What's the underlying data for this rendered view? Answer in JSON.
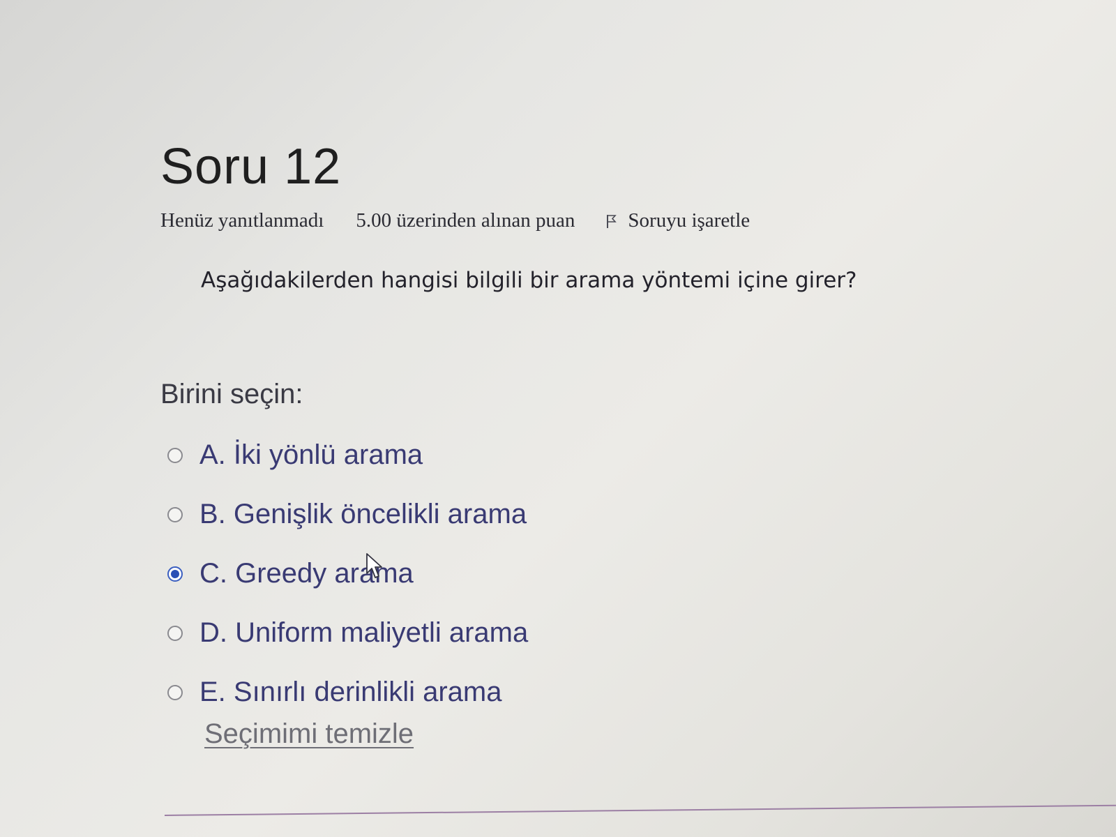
{
  "question": {
    "title": "Soru 12",
    "status": "Henüz yanıtlanmadı",
    "grade": "5.00 üzerinden alınan puan",
    "flag_label": "Soruyu işaretle",
    "text": "Aşağıdakilerden hangisi bilgili bir arama yöntemi içine girer?"
  },
  "answer_prompt": "Birini seçin:",
  "answers": [
    {
      "label": "A. İki yönlü arama",
      "selected": false
    },
    {
      "label": "B. Genişlik öncelikli arama",
      "selected": false
    },
    {
      "label": "C. Greedy arama",
      "selected": true
    },
    {
      "label": "D. Uniform maliyetli arama",
      "selected": false
    },
    {
      "label": "E. Sınırlı derinlikli arama",
      "selected": false
    }
  ],
  "clear_link": "Seçimimi temizle",
  "icons": {
    "flag": "flag-icon",
    "cursor": "mouse-pointer-icon"
  },
  "colors": {
    "answer_text": "#393a73",
    "radio_selected": "#2a4fb5",
    "divider": "#9c7fa4"
  }
}
